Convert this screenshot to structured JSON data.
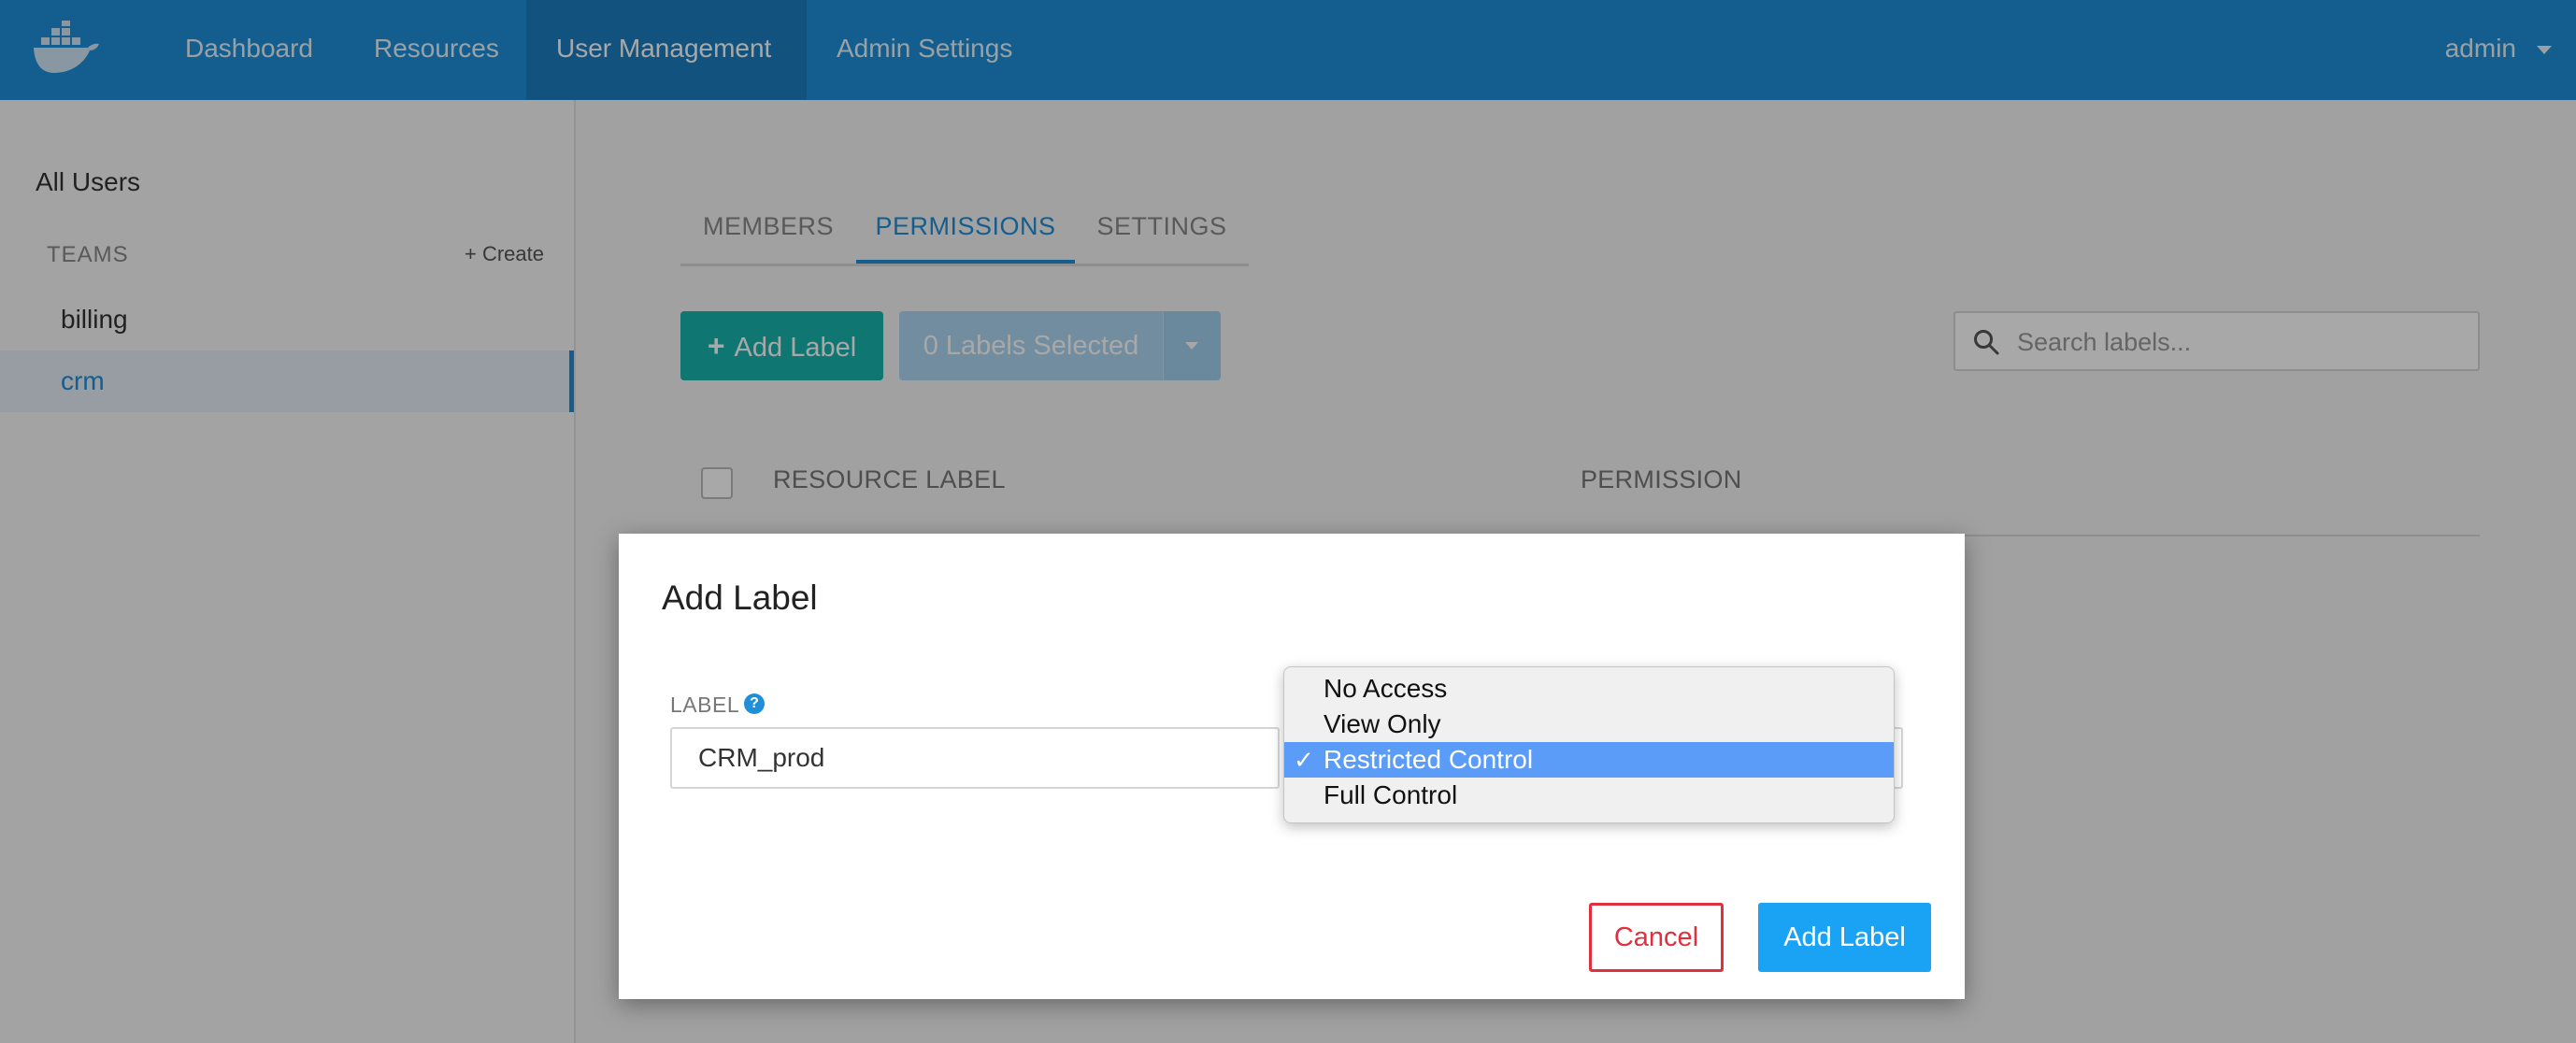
{
  "colors": {
    "topbar": "#1f8fd9",
    "nav_active": "#1a7ec0",
    "accent_teal": "#17b3ad",
    "accent_blue": "#1f8fd9",
    "danger": "#e0303d",
    "selected_option": "#5a9cf8"
  },
  "topnav": {
    "logo_icon": "docker-whale-icon",
    "items": [
      {
        "label": "Dashboard"
      },
      {
        "label": "Resources"
      },
      {
        "label": "User Management",
        "active": true
      },
      {
        "label": "Admin Settings"
      }
    ],
    "user": "admin"
  },
  "sidebar": {
    "all_users": "All Users",
    "teams_label": "TEAMS",
    "create_link": "+ Create",
    "teams": [
      {
        "label": "billing"
      },
      {
        "label": "crm",
        "selected": true
      }
    ]
  },
  "main": {
    "tabs": [
      {
        "label": "MEMBERS"
      },
      {
        "label": "PERMISSIONS",
        "active": true
      },
      {
        "label": "SETTINGS"
      }
    ],
    "add_label_button": "Add Label",
    "labels_selected": "0 Labels Selected",
    "search": {
      "placeholder": "Search labels...",
      "value": ""
    },
    "table": {
      "columns": [
        "RESOURCE LABEL",
        "PERMISSION"
      ]
    }
  },
  "modal": {
    "title": "Add Label",
    "label_field": {
      "label": "LABEL",
      "help_icon": "question-icon",
      "value": "CRM_prod"
    },
    "permission_select": {
      "options": [
        "No Access",
        "View Only",
        "Restricted Control",
        "Full Control"
      ],
      "selected": "Restricted Control",
      "check_glyph": "✓"
    },
    "cancel_button": "Cancel",
    "submit_button": "Add Label"
  }
}
